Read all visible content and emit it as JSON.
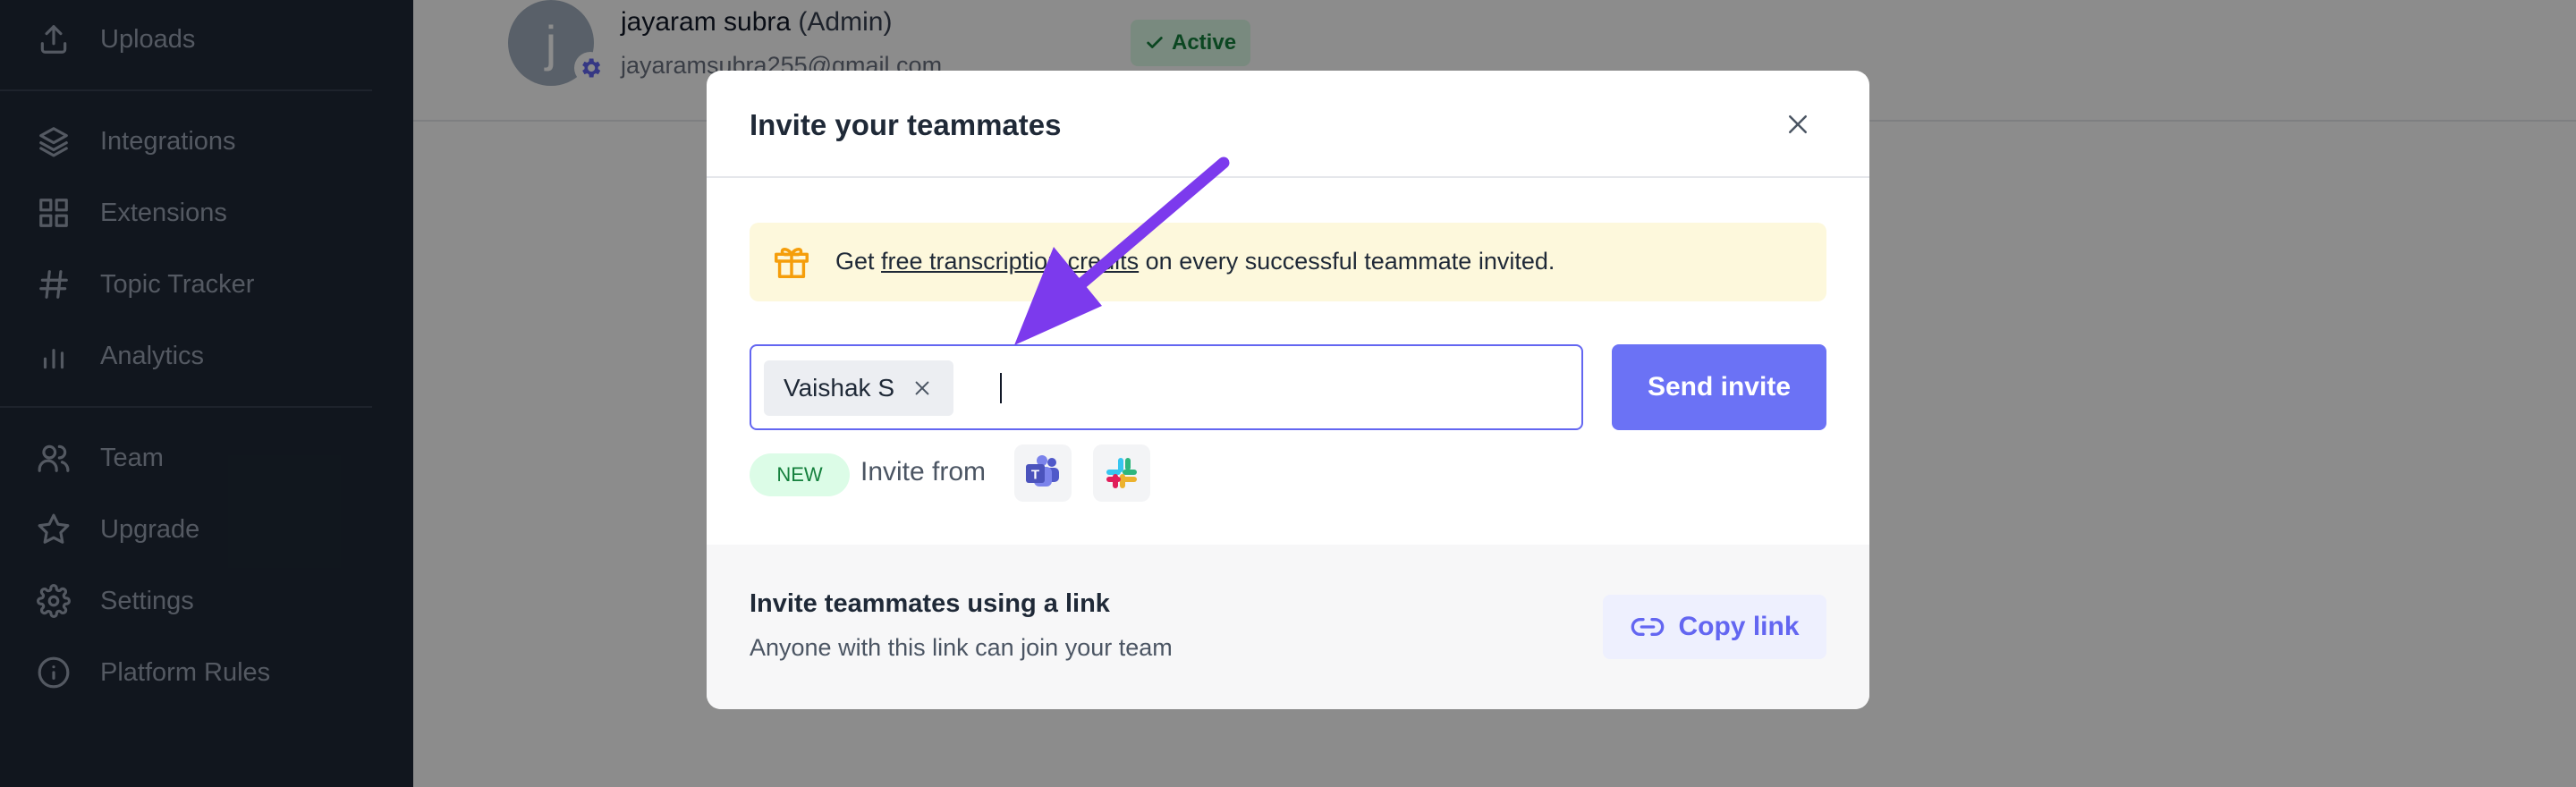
{
  "sidebar": {
    "items": [
      {
        "label": "Uploads",
        "icon": "upload-icon"
      },
      {
        "label": "Integrations",
        "icon": "layers-icon"
      },
      {
        "label": "Extensions",
        "icon": "grid-icon"
      },
      {
        "label": "Topic Tracker",
        "icon": "hash-icon"
      },
      {
        "label": "Analytics",
        "icon": "bar-chart-icon"
      },
      {
        "label": "Team",
        "icon": "users-icon"
      },
      {
        "label": "Upgrade",
        "icon": "star-icon"
      },
      {
        "label": "Settings",
        "icon": "gear-icon"
      },
      {
        "label": "Platform Rules",
        "icon": "info-icon"
      }
    ]
  },
  "user": {
    "avatar_letter": "j",
    "name": "jayaram subra",
    "role": "(Admin)",
    "email": "jayaramsubra255@gmail.com",
    "status": "Active"
  },
  "modal": {
    "title": "Invite your teammates",
    "promo": {
      "prefix": "Get ",
      "link": "free transcription credits",
      "suffix": " on every successful teammate invited."
    },
    "invite_chip": "Vaishak S",
    "send_label": "Send invite",
    "new_badge": "NEW",
    "invite_from": "Invite from",
    "apps": [
      "teams-icon",
      "slack-icon"
    ],
    "footer": {
      "title": "Invite teammates using a link",
      "subtitle": "Anyone with this link can join your team",
      "copy_label": "Copy link"
    }
  },
  "colors": {
    "sidebar_bg": "#1f2937",
    "accent": "#6366f1",
    "send_button": "#6b72f5",
    "promo_bg": "#fdf8dc",
    "annotation_arrow": "#7c3aed",
    "success": "#15803d"
  }
}
